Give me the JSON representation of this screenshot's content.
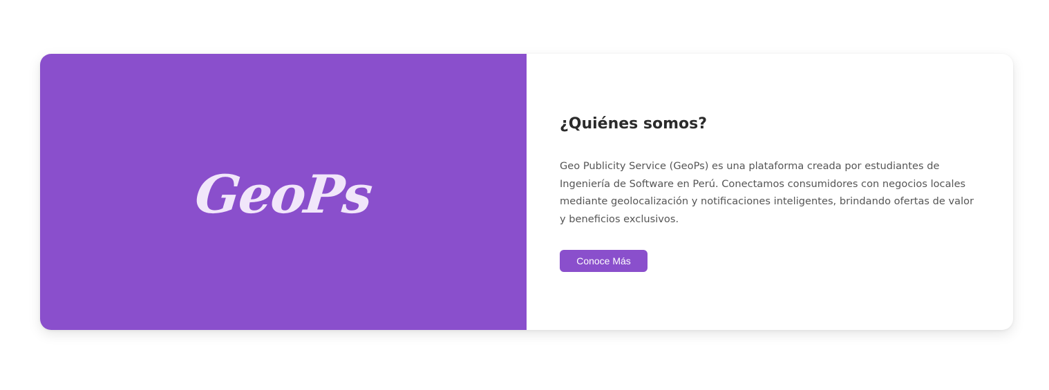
{
  "about": {
    "logo_text": "GeoPs",
    "title": "¿Quiénes somos?",
    "description": "Geo Publicity Service (GeoPs) es una plataforma creada por estudiantes de Ingeniería de Software en Perú. Conectamos consumidores con negocios locales mediante geolocalización y notificaciones inteligentes, brindando ofertas de valor y beneficios exclusivos.",
    "button_label": "Conoce Más"
  },
  "colors": {
    "brand": "#8a4fcc",
    "logo_text": "#f1e6fa",
    "title": "#2b2b2b",
    "body_text": "#555555",
    "background": "#ffffff"
  }
}
